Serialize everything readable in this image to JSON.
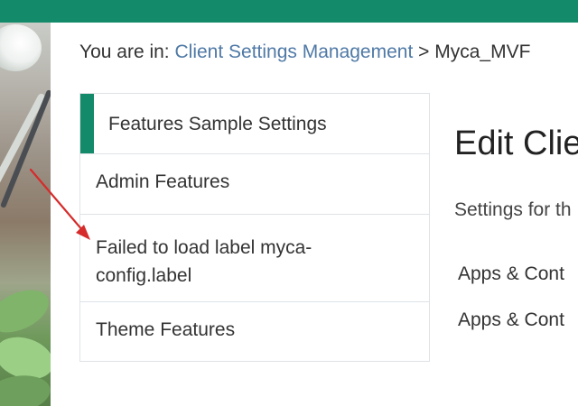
{
  "topbar": {
    "text": "",
    "color": "#138a6a"
  },
  "breadcrumb": {
    "prefix": "You are in:",
    "link": "Client Settings Management",
    "separator": ">",
    "current": "Myca_MVF"
  },
  "nav": {
    "items": [
      {
        "label": "Features Sample Settings",
        "active": true
      },
      {
        "label": "Admin Features",
        "active": false
      },
      {
        "label": "Failed to load label myca-config.label",
        "active": false
      },
      {
        "label": "Theme Features",
        "active": false
      }
    ]
  },
  "main": {
    "title": "Edit Clie",
    "subtitle": "Settings for th",
    "apps": [
      {
        "label": "Apps & Cont"
      },
      {
        "label": "Apps & Cont"
      }
    ]
  },
  "annotation": {
    "color": "#d62b2b",
    "icon": "red-arrow"
  }
}
